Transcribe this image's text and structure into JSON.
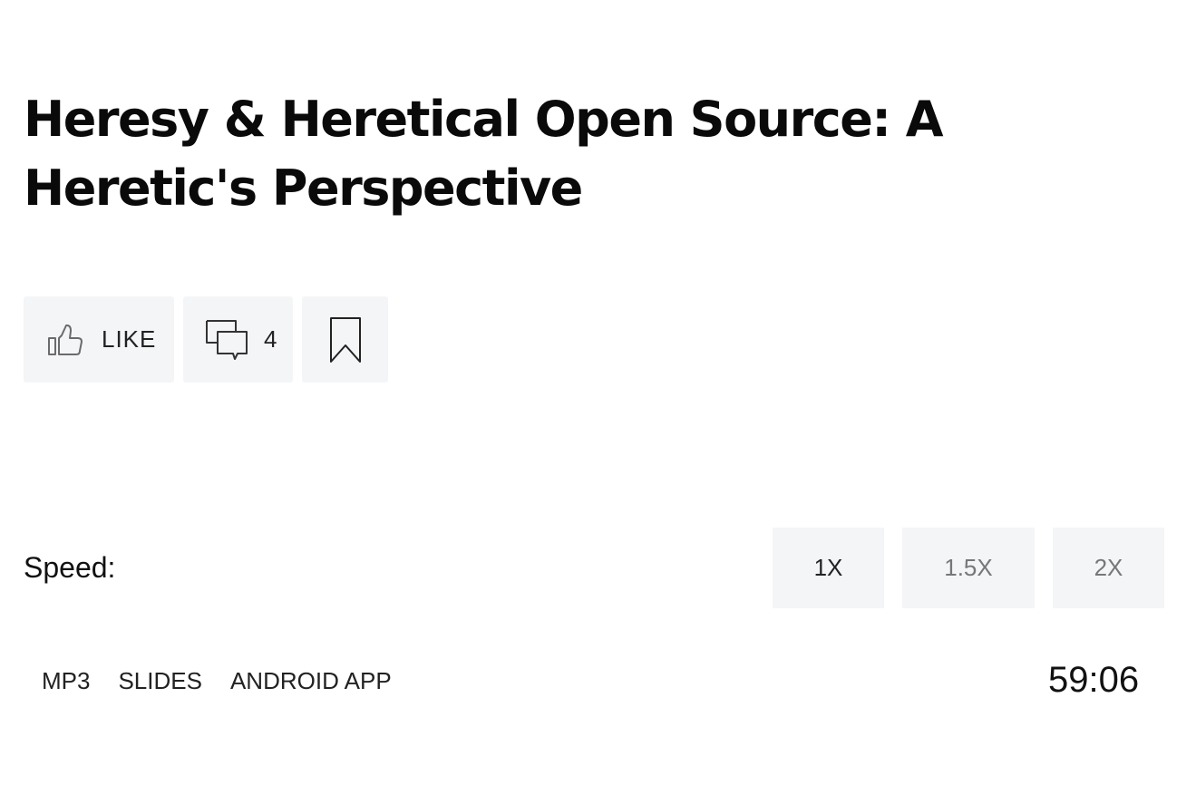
{
  "episode": {
    "title": "Heresy & Heretical Open Source: A Heretic's Perspective"
  },
  "actions": {
    "like_label": "LIKE",
    "comments_count": "4",
    "like_icon": "thumbs-up-icon",
    "comments_icon": "comments-icon",
    "bookmark_icon": "bookmark-icon"
  },
  "player": {
    "speed_label": "Speed:",
    "speeds": [
      "1X",
      "1.5X",
      "2X"
    ],
    "selected_speed": "1X",
    "duration": "59:06"
  },
  "links": [
    "MP3",
    "SLIDES",
    "ANDROID APP"
  ],
  "colors": {
    "button_bg": "#f4f5f7",
    "text": "#111111",
    "inactive_text": "#777777"
  }
}
